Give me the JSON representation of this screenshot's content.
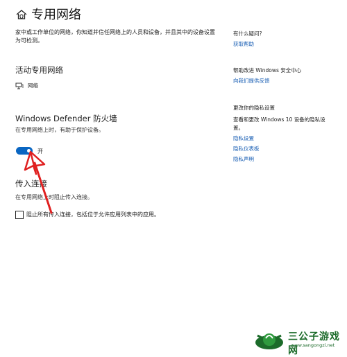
{
  "header": {
    "title": "专用网络",
    "icon": "home-shield-icon"
  },
  "description": "家中或工作单位的网络，你知道并信任网络上的人员和设备，并且其中的设备设置为可检测。",
  "active_network": {
    "heading": "活动专用网络",
    "network_name": "网络",
    "icon": "network-icon"
  },
  "firewall": {
    "heading": "Windows Defender 防火墙",
    "description": "在专用网络上时，有助于保护设备。",
    "toggle_state": "开",
    "toggle_on": true,
    "accent_color": "#0a66c2"
  },
  "incoming": {
    "heading": "传入连接",
    "description": "在专用网络上时阻止传入连接。",
    "checkbox_label": "阻止所有传入连接，包括位于允许应用列表中的应用。",
    "checked": false
  },
  "sidebar": {
    "questions_heading": "有什么疑问?",
    "get_help": "获取帮助",
    "improve_heading": "帮助改进 Windows 安全中心",
    "feedback": "向我们提供反馈",
    "privacy_heading": "更改你的隐私设置",
    "privacy_text": "查看和更改 Windows 10 设备的隐私设置。",
    "privacy_settings": "隐私设置",
    "privacy_dashboard": "隐私仪表板",
    "privacy_statement": "隐私声明"
  },
  "watermark": {
    "name": "三公子游戏网",
    "url": "www.sangongzi.net"
  }
}
